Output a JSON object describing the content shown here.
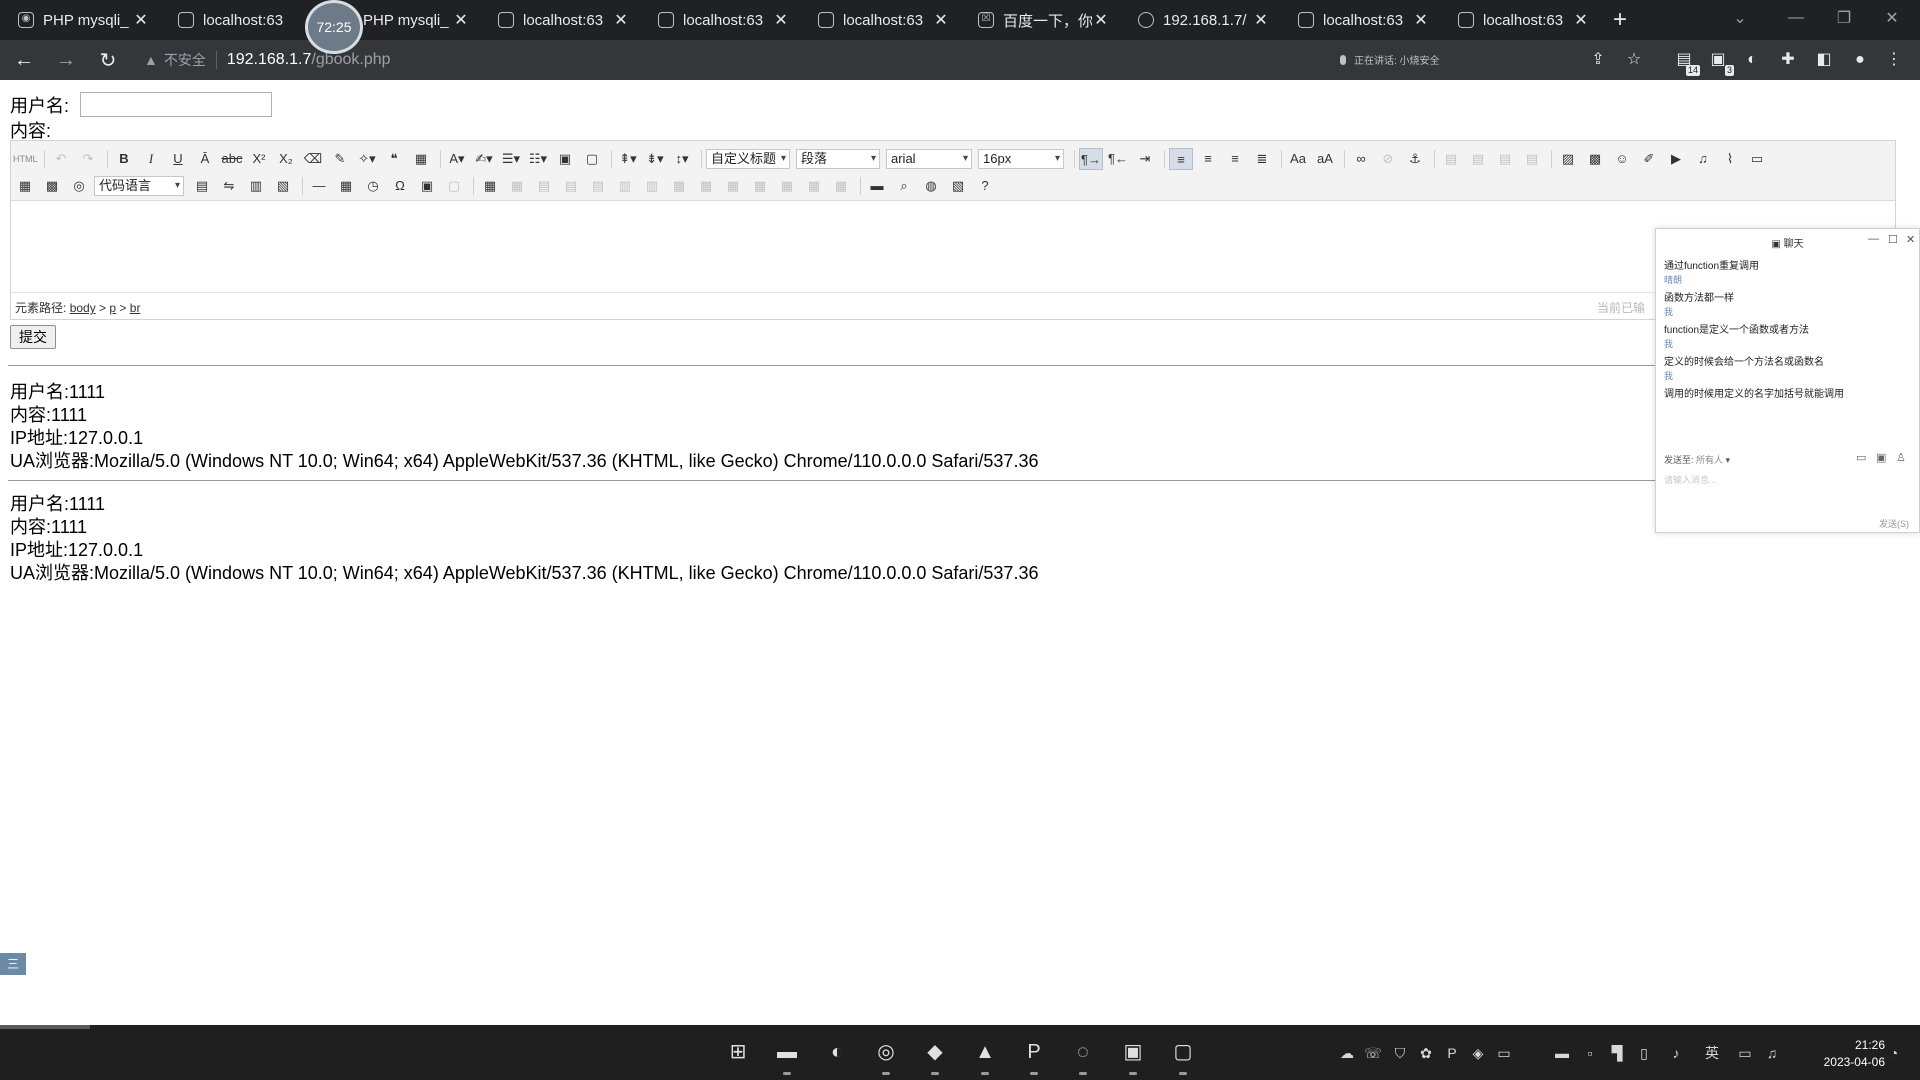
{
  "browser": {
    "tabs": [
      {
        "label": "PHP mysqli_",
        "icon": "app-icon"
      },
      {
        "label": "localhost:63",
        "icon": "page-icon"
      },
      {
        "label": "PHP mysqli_",
        "icon": "page-icon"
      },
      {
        "label": "localhost:63",
        "icon": "page-icon"
      },
      {
        "label": "localhost:63",
        "icon": "page-icon"
      },
      {
        "label": "localhost:63",
        "icon": "page-icon"
      },
      {
        "label": "百度一下，你",
        "icon": "baidu-icon"
      },
      {
        "label": "192.168.1.7/",
        "icon": "globe-icon"
      },
      {
        "label": "localhost:63",
        "icon": "page-icon"
      },
      {
        "label": "localhost:63",
        "icon": "page-icon"
      }
    ],
    "timer": "72:25",
    "address": {
      "not_secure": "不安全",
      "host": "192.168.1.7",
      "path": "/gbook.php"
    },
    "recording": "正在讲话: 小烧安全",
    "badges": {
      "extension_a": "14",
      "extension_b": "3"
    }
  },
  "form": {
    "username_label": "用户名:",
    "content_label": "内容:",
    "submit_label": "提交"
  },
  "editor": {
    "combos": {
      "custom_title": "自定义标题",
      "paragraph": "段落",
      "font_family": "arial",
      "font_size": "16px",
      "code_language": "代码语言"
    },
    "status_prefix": "元素路径:",
    "path": [
      "body",
      "p",
      "br"
    ],
    "status_right": "当前已输"
  },
  "entries": [
    {
      "username_label": "用户名:",
      "username": "1111",
      "content_label": "内容:",
      "content": "1111",
      "ip_label": "IP地址:",
      "ip": "127.0.0.1",
      "ua_label": "UA浏览器:",
      "ua": "Mozilla/5.0 (Windows NT 10.0; Win64; x64) AppleWebKit/537.36 (KHTML, like Gecko) Chrome/110.0.0.0 Safari/537.36"
    },
    {
      "username_label": "用户名:",
      "username": "1111",
      "content_label": "内容:",
      "content": "1111",
      "ip_label": "IP地址:",
      "ip": "127.0.0.1",
      "ua_label": "UA浏览器:",
      "ua": "Mozilla/5.0 (Windows NT 10.0; Win64; x64) AppleWebKit/537.36 (KHTML, like Gecko) Chrome/110.0.0.0 Safari/537.36"
    }
  ],
  "chat": {
    "title": "聊天",
    "messages": [
      {
        "text": "通过function重复调用",
        "sender": "晴朗"
      },
      {
        "text": "函数方法都一样",
        "sender": "我"
      },
      {
        "text": "function是定义一个函数或者方法",
        "sender": "我"
      },
      {
        "text": "定义的时候会给一个方法名或函数名",
        "sender": "我"
      },
      {
        "text": "调用的时候用定义的名字加括号就能调用",
        "sender": ""
      }
    ],
    "send_to_label": "发送至:",
    "send_to_value": "所有人",
    "input_placeholder": "请输入消息...",
    "send_label": "发送(S)"
  },
  "side_tab": "三",
  "taskbar": {
    "clock_time": "21:26",
    "clock_date": "2023-04-06",
    "ime": "英"
  }
}
